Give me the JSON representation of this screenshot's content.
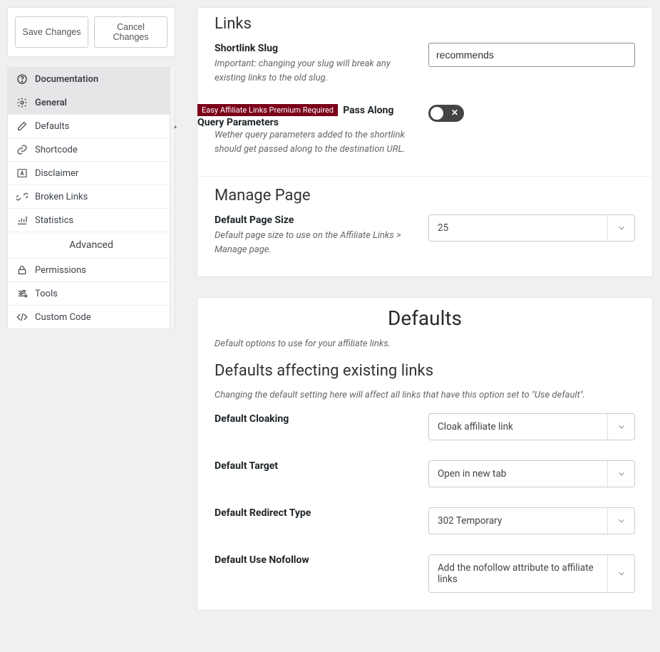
{
  "buttons": {
    "save": "Save Changes",
    "cancel": "Cancel Changes"
  },
  "nav": {
    "documentation": "Documentation",
    "general": "General",
    "defaults": "Defaults",
    "shortcode": "Shortcode",
    "disclaimer": "Disclaimer",
    "broken_links": "Broken Links",
    "statistics": "Statistics",
    "advanced_section": "Advanced",
    "permissions": "Permissions",
    "tools": "Tools",
    "custom_code": "Custom Code"
  },
  "links_section": {
    "title": "Links",
    "slug_label": "Shortlink Slug",
    "slug_help": "Important: changing your slug will break any existing links to the old slug.",
    "slug_value": "recommends",
    "premium_badge": "Easy Affiliate Links Premium Required",
    "pass_label": "Pass Along Query Parameters",
    "pass_help": "Wether query parameters added to the shortlink should get passed along to the destination URL."
  },
  "manage_section": {
    "title": "Manage Page",
    "pagesize_label": "Default Page Size",
    "pagesize_help": "Default page size to use on the Affiliate Links > Manage page.",
    "pagesize_value": "25"
  },
  "defaults_panel": {
    "title": "Defaults",
    "subtitle": "Default options to use for your affiliate links.",
    "existing_title": "Defaults affecting existing links",
    "existing_sub": "Changing the default setting here will affect all links that have this option set to \"Use default\".",
    "cloaking_label": "Default Cloaking",
    "cloaking_value": "Cloak affiliate link",
    "target_label": "Default Target",
    "target_value": "Open in new tab",
    "redirect_label": "Default Redirect Type",
    "redirect_value": "302 Temporary",
    "nofollow_label": "Default Use Nofollow",
    "nofollow_value": "Add the nofollow attribute to affiliate links"
  }
}
